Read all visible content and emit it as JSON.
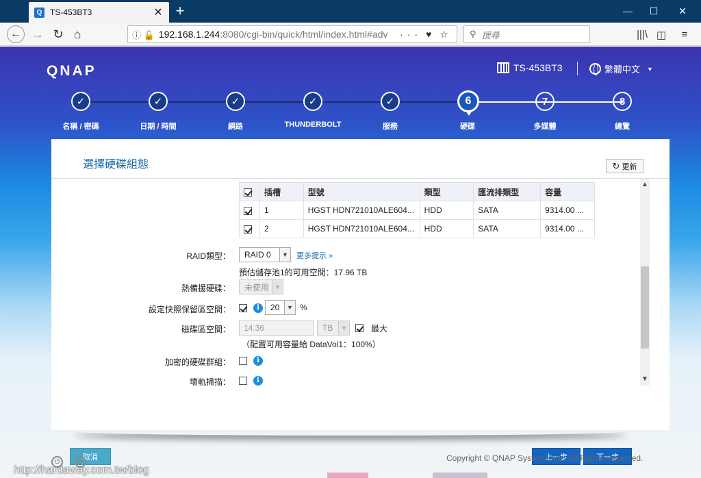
{
  "browser": {
    "tab_title": "TS-453BT3",
    "tab_favicon": "Q",
    "url_host": "192.168.1.244",
    "url_rest": ":8080/cgi-bin/quick/html/index.html#adv",
    "search_placeholder": "搜尋"
  },
  "header": {
    "logo": "QNAP",
    "device_name": "TS-453BT3",
    "language": "繁體中文"
  },
  "steps": [
    {
      "label": "名稱 / 密碼",
      "number": "✓",
      "state": "done"
    },
    {
      "label": "日期 / 時間",
      "number": "✓",
      "state": "done"
    },
    {
      "label": "網路",
      "number": "✓",
      "state": "done"
    },
    {
      "label": "THUNDERBOLT",
      "number": "✓",
      "state": "done"
    },
    {
      "label": "服務",
      "number": "✓",
      "state": "done"
    },
    {
      "label": "硬碟",
      "number": "6",
      "state": "current"
    },
    {
      "label": "多媒體",
      "number": "7",
      "state": "todo"
    },
    {
      "label": "總覽",
      "number": "8",
      "state": "todo"
    }
  ],
  "dialog": {
    "title": "選擇硬碟組態",
    "refresh_label": "更新",
    "table": {
      "headers": [
        "插槽",
        "型號",
        "類型",
        "匯流排類型",
        "容量"
      ],
      "rows": [
        {
          "slot": "1",
          "model": "HGST HDN721010ALE604...",
          "type": "HDD",
          "bus": "SATA",
          "capacity": "9314.00 ..."
        },
        {
          "slot": "2",
          "model": "HGST HDN721010ALE604...",
          "type": "HDD",
          "bus": "SATA",
          "capacity": "9314.00 ..."
        }
      ]
    },
    "raid_label": "RAID類型：",
    "raid_value": "RAID 0",
    "more_hints": "更多提示 »",
    "pool_capacity": "預估儲存池1的可用空間：17.96 TB",
    "hot_spare_label": "熱備援硬碟：",
    "hot_spare_value": "未使用",
    "snapshot_label": "設定快照保留區空間：",
    "snapshot_value": "20",
    "snapshot_unit": "%",
    "volume_label": "磁碟區空間：",
    "volume_value": "14.36",
    "volume_unit": "TB",
    "max_label": "最大",
    "allocation_note": "（配置可用容量給 DataVol1：100%）",
    "encrypt_label": "加密的硬碟群組：",
    "scrub_label": "壞軌掃描：",
    "cancel_label": "取消",
    "prev_label": "上一步",
    "next_label": "下一步"
  },
  "footer": {
    "copyright": "Copyright © QNAP Systems, Inc. All Rights Reserved.",
    "watermark": "http://hardaway.com.tw/blog"
  }
}
